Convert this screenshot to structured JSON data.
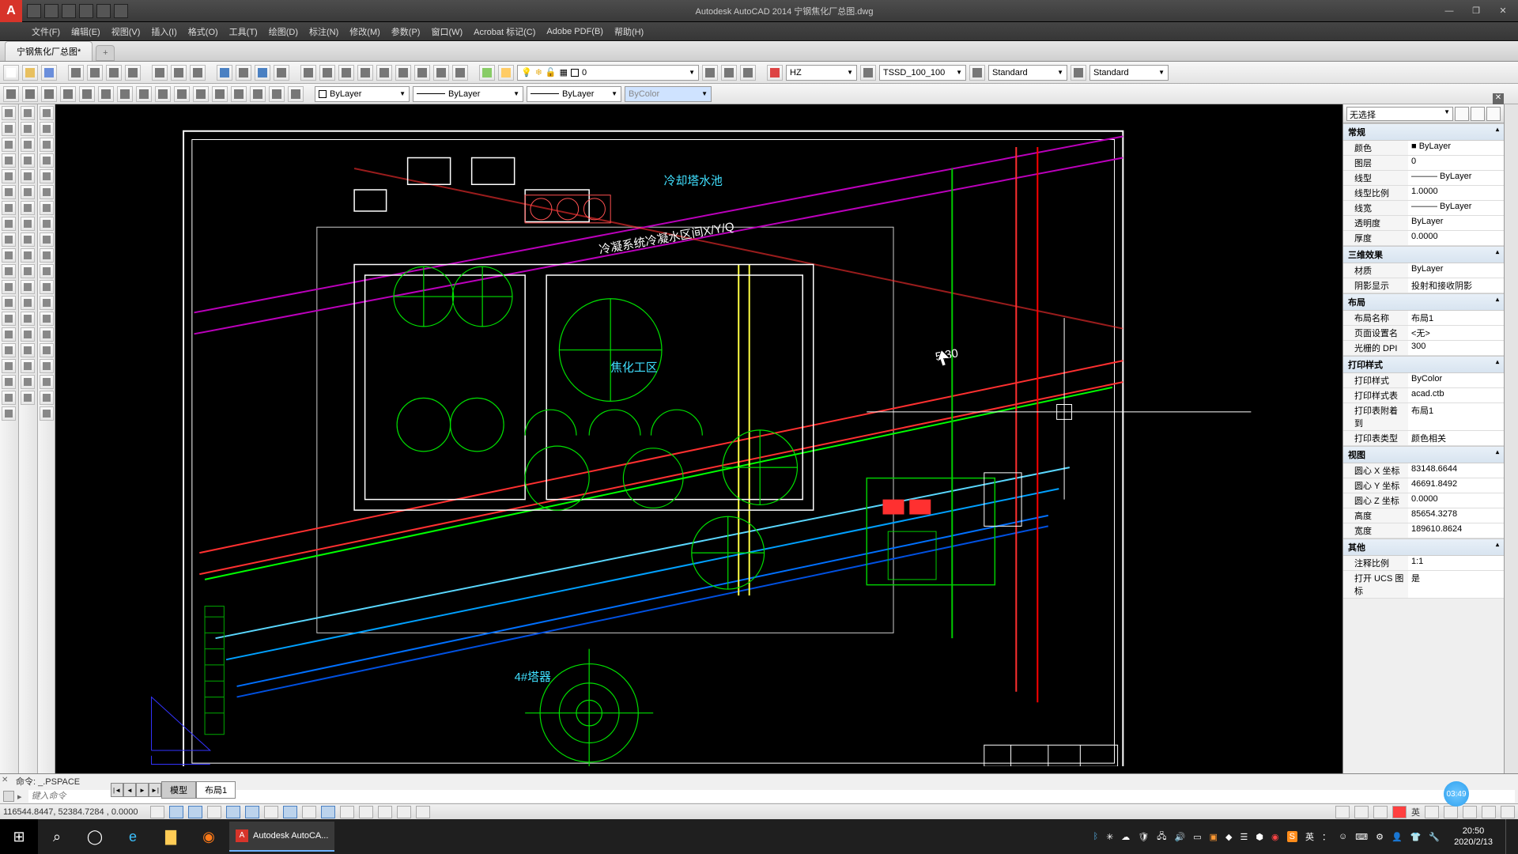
{
  "title": "Autodesk AutoCAD 2014    宁钢焦化厂总图.dwg",
  "window_buttons": {
    "min": "—",
    "max": "❐",
    "close": "✕"
  },
  "qat_icons": [
    "new",
    "open",
    "save",
    "undo",
    "redo",
    "plot"
  ],
  "menus": [
    "文件(F)",
    "编辑(E)",
    "视图(V)",
    "插入(I)",
    "格式(O)",
    "工具(T)",
    "绘图(D)",
    "标注(N)",
    "修改(M)",
    "参数(P)",
    "窗口(W)",
    "Acrobat 标记(C)",
    "Adobe PDF(B)",
    "帮助(H)"
  ],
  "doc_tab": "宁钢焦化厂总图*",
  "toolbar1": {
    "layer_combo": "0",
    "font_combo": "HZ",
    "dim_combo": "TSSD_100_100",
    "std_combo1": "Standard",
    "std_combo2": "Standard"
  },
  "toolbar2": {
    "bylayer1": "ByLayer",
    "bylayer2": "ByLayer",
    "bylayer3": "ByLayer",
    "bycolor": "ByColor"
  },
  "model_tabs": {
    "nav": [
      "|◄",
      "◄",
      "►",
      "►|"
    ],
    "tabs": [
      "模型",
      "布局1"
    ]
  },
  "command": {
    "history": "命令:  _.PSPACE",
    "placeholder": "键入命令"
  },
  "status": {
    "coords": "116544.8447,  52384.7284 ,  0.0000"
  },
  "time_badge": "03:49",
  "props": {
    "selection": "无选择",
    "groups": [
      {
        "title": "常规",
        "rows": [
          {
            "k": "颜色",
            "v": "■ ByLayer"
          },
          {
            "k": "图层",
            "v": "0"
          },
          {
            "k": "线型",
            "v": "——— ByLayer"
          },
          {
            "k": "线型比例",
            "v": "1.0000"
          },
          {
            "k": "线宽",
            "v": "——— ByLayer"
          },
          {
            "k": "透明度",
            "v": "ByLayer"
          },
          {
            "k": "厚度",
            "v": "0.0000"
          }
        ]
      },
      {
        "title": "三维效果",
        "rows": [
          {
            "k": "材质",
            "v": "ByLayer"
          },
          {
            "k": "阴影显示",
            "v": "投射和接收阴影"
          }
        ]
      },
      {
        "title": "布局",
        "rows": [
          {
            "k": "布局名称",
            "v": "布局1"
          },
          {
            "k": "页面设置名",
            "v": "<无>"
          },
          {
            "k": "光栅的 DPI",
            "v": "300"
          }
        ]
      },
      {
        "title": "打印样式",
        "rows": [
          {
            "k": "打印样式",
            "v": "ByColor"
          },
          {
            "k": "打印样式表",
            "v": "acad.ctb"
          },
          {
            "k": "打印表附着到",
            "v": "布局1"
          },
          {
            "k": "打印表类型",
            "v": "颜色相关"
          }
        ]
      },
      {
        "title": "视图",
        "rows": [
          {
            "k": "圆心 X 坐标",
            "v": "83148.6644"
          },
          {
            "k": "圆心 Y 坐标",
            "v": "46691.8492"
          },
          {
            "k": "圆心 Z 坐标",
            "v": "0.0000"
          },
          {
            "k": "高度",
            "v": "85654.3278"
          },
          {
            "k": "宽度",
            "v": "189610.8624"
          }
        ]
      },
      {
        "title": "其他",
        "rows": [
          {
            "k": "注释比例",
            "v": "1:1"
          },
          {
            "k": "打开 UCS 图标",
            "v": "是"
          }
        ]
      }
    ]
  },
  "taskbar": {
    "running": "Autodesk AutoCA...",
    "clock_time": "20:50",
    "clock_date": "2020/2/13",
    "ime": "英",
    "sogou": "S"
  },
  "drawing_labels": {
    "p1": "冷却塔水池",
    "p2": "焦化工区",
    "p3": "4#塔器",
    "p4": "冷凝系统冷凝水区间X/Y/Q"
  }
}
